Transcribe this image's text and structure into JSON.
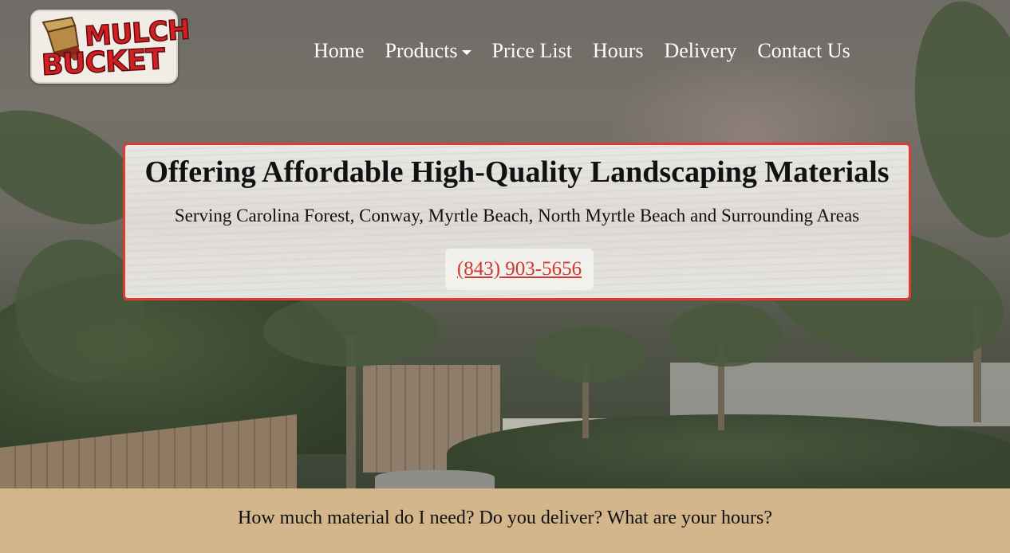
{
  "brand": {
    "logo_line1": "MULCH",
    "logo_line2": "BUCKET"
  },
  "nav": {
    "items": [
      {
        "label": "Home",
        "has_dropdown": false
      },
      {
        "label": "Products",
        "has_dropdown": true
      },
      {
        "label": "Price List",
        "has_dropdown": false
      },
      {
        "label": "Hours",
        "has_dropdown": false
      },
      {
        "label": "Delivery",
        "has_dropdown": false
      },
      {
        "label": "Contact Us",
        "has_dropdown": false
      }
    ]
  },
  "banner": {
    "title": "Offering Affordable High-Quality Landscaping Materials",
    "subtitle": "Serving Carolina Forest, Conway, Myrtle Beach, North Myrtle Beach and Surrounding Areas",
    "phone": "(843) 903-5656"
  },
  "faq": {
    "text": "How much material do I need? Do you deliver? What are your hours?"
  },
  "colors": {
    "accent_red": "#e03a31",
    "nav_text": "#ffffff",
    "strip_background": "#d3b68c"
  }
}
